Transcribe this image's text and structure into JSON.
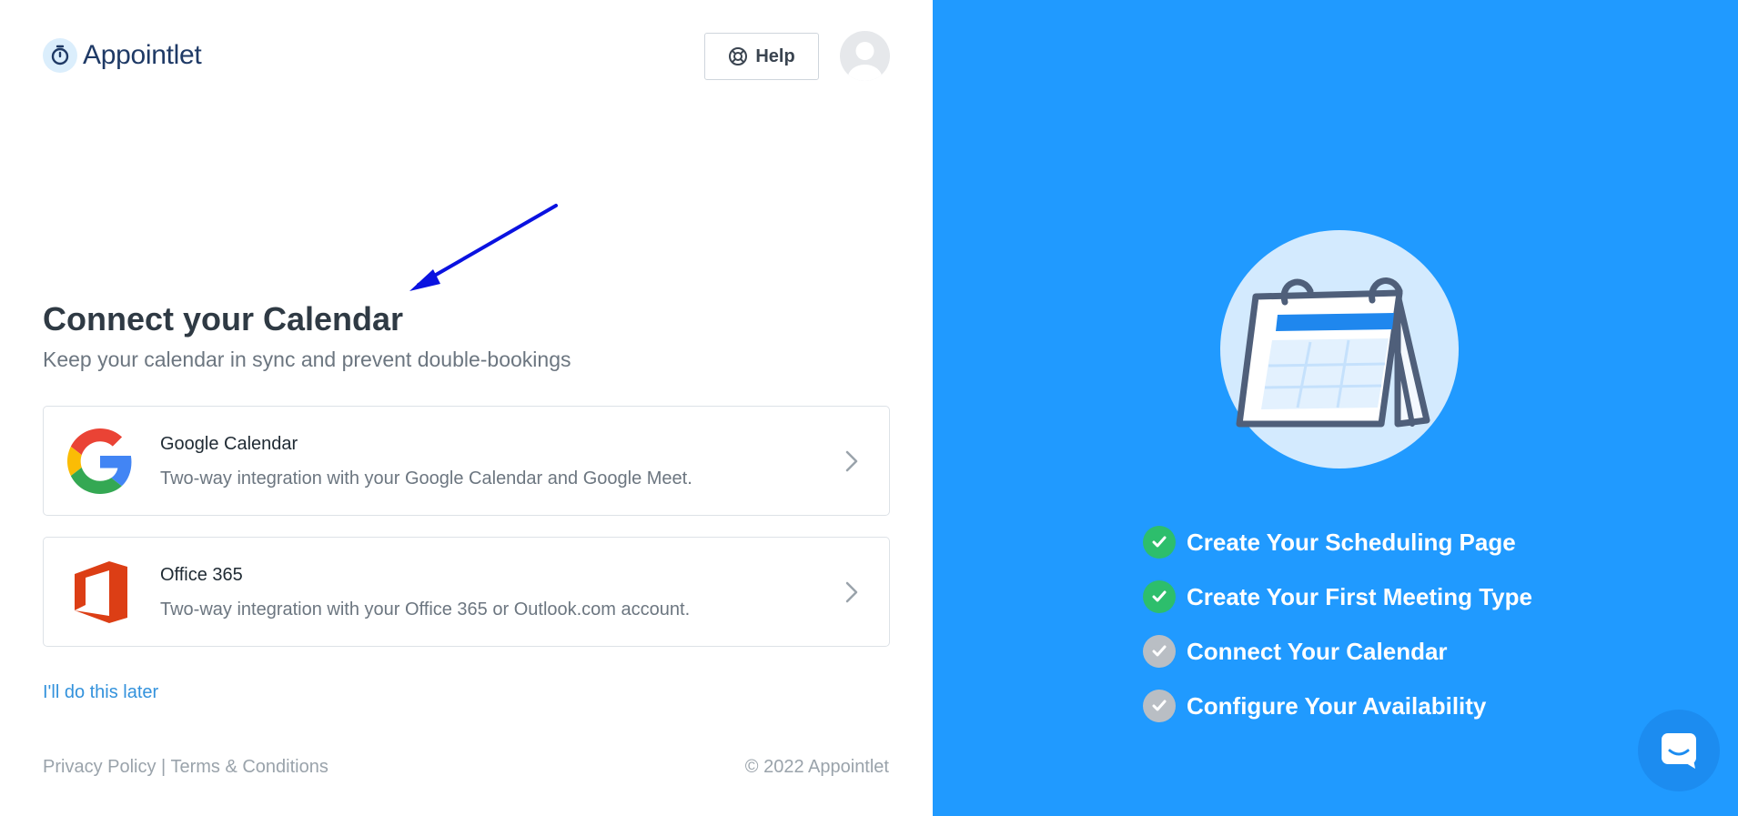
{
  "brand": {
    "name": "Appointlet"
  },
  "header": {
    "help_label": "Help"
  },
  "page": {
    "title": "Connect your Calendar",
    "subtitle": "Keep your calendar in sync and prevent double-bookings"
  },
  "integrations": [
    {
      "icon": "google-logo-icon",
      "title": "Google Calendar",
      "description": "Two-way integration with your Google Calendar and Google Meet."
    },
    {
      "icon": "office365-logo-icon",
      "title": "Office 365",
      "description": "Two-way integration with your Office 365 or Outlook.com account."
    }
  ],
  "skip_label": "I'll do this later",
  "footer": {
    "privacy": "Privacy Policy",
    "separator": "|",
    "terms": "Terms & Conditions",
    "copyright": "© 2022 Appointlet"
  },
  "checklist": [
    {
      "label": "Create Your Scheduling Page",
      "done": true
    },
    {
      "label": "Create Your First Meeting Type",
      "done": true
    },
    {
      "label": "Connect Your Calendar",
      "done": false
    },
    {
      "label": "Configure Your Availability",
      "done": false
    }
  ],
  "colors": {
    "accent": "#209aff",
    "done": "#2dbe6c",
    "pending": "#b9bec4",
    "link": "#3392dc"
  }
}
